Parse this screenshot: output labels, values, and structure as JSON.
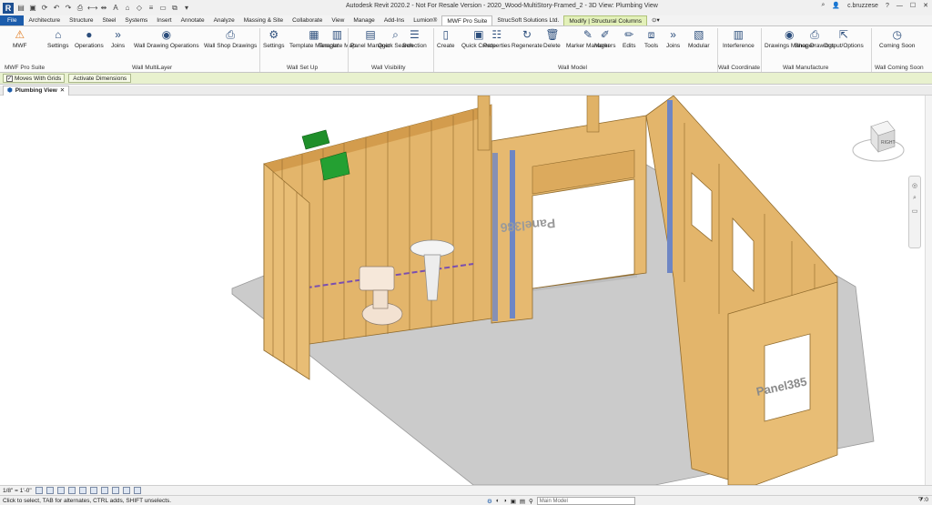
{
  "window": {
    "title": "Autodesk Revit 2020.2 - Not For Resale Version - 2020_Wood-MultiStory-Framed_2 - 3D View: Plumbing View",
    "logo": "R",
    "user": "c.bruzzese"
  },
  "tabs": [
    "File",
    "Architecture",
    "Structure",
    "Steel",
    "Systems",
    "Insert",
    "Annotate",
    "Analyze",
    "Massing & Site",
    "Collaborate",
    "View",
    "Manage",
    "Add-Ins",
    "Lumion®",
    "MWF Pro Suite",
    "StrucSoft Solutions Ltd.",
    "Modify | Structural Columns"
  ],
  "ribbon": {
    "buttons": [
      "MWF",
      "Settings",
      "Operations",
      "Joins",
      "Wall Drawing Operations",
      "Wall Shop Drawings",
      "Settings",
      "Template Manager",
      "Template Map",
      "Panel Manager",
      "Quick Search",
      "Selection",
      "Create",
      "Quick Create",
      "Properties",
      "Regenerate",
      "Delete",
      "Marker Manager",
      "Markers",
      "Edits",
      "Tools",
      "Joins",
      "Modular",
      "Interference",
      "Drawings Manager",
      "Shop Drawings",
      "Output/Options",
      "Coming Soon"
    ],
    "panels": [
      "MWF Pro Suite",
      "Wall MultiLayer",
      "Wall Set Up",
      "Wall Visibility",
      "Wall Model",
      "Wall Coordinate",
      "Wall Manufacture",
      "Wall Coming Soon"
    ]
  },
  "options_bar": {
    "moves_with_grids": "Moves With Grids",
    "activate_dimensions": "Activate Dimensions"
  },
  "view_tab": {
    "label": "Plumbing View",
    "close": "✕"
  },
  "model": {
    "panel_labels": [
      "Panel386",
      "Panel385"
    ],
    "cube_face": "RIGHT"
  },
  "view_control": {
    "scale": "1/8\" = 1'-0\""
  },
  "status": {
    "message": "Click to select, TAB for alternates, CTRL adds, SHIFT unselects.",
    "model_select": "Main Model",
    "filter_count": ":0"
  },
  "colors": {
    "file_tab": "#1c5cab",
    "modify_tab": "#e3f1b9",
    "wood": "#e2b66d",
    "floor": "#c9c9c9",
    "stud_blue": "#6e86c4"
  }
}
